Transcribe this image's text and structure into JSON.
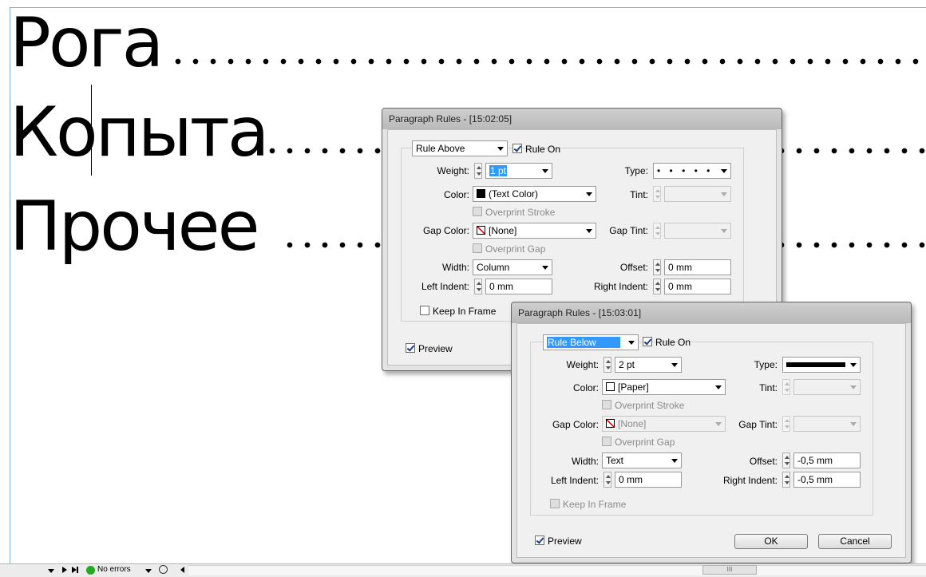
{
  "document": {
    "paragraphs": [
      "Рога",
      "Копыта",
      "Прочее"
    ]
  },
  "dialog_above": {
    "title": "Paragraph Rules - [15:02:05]",
    "rule_select": "Rule Above",
    "rule_on_label": "Rule On",
    "weight_label": "Weight:",
    "weight_value": "1 pt",
    "type_label": "Type:",
    "type_value": "• • • • •",
    "color_label": "Color:",
    "color_value": "(Text Color)",
    "tint_label": "Tint:",
    "overprint_stroke_label": "Overprint Stroke",
    "gap_color_label": "Gap Color:",
    "gap_color_value": "[None]",
    "gap_tint_label": "Gap Tint:",
    "overprint_gap_label": "Overprint Gap",
    "width_label": "Width:",
    "width_value": "Column",
    "offset_label": "Offset:",
    "offset_value": "0 mm",
    "left_indent_label": "Left Indent:",
    "left_indent_value": "0 mm",
    "right_indent_label": "Right Indent:",
    "right_indent_value": "0 mm",
    "keep_in_frame_label": "Keep In Frame",
    "preview_label": "Preview"
  },
  "dialog_below": {
    "title": "Paragraph Rules - [15:03:01]",
    "rule_select": "Rule Below",
    "rule_on_label": "Rule On",
    "weight_label": "Weight:",
    "weight_value": "2 pt",
    "type_label": "Type:",
    "color_label": "Color:",
    "color_value": "[Paper]",
    "tint_label": "Tint:",
    "overprint_stroke_label": "Overprint Stroke",
    "gap_color_label": "Gap Color:",
    "gap_color_value": "[None]",
    "gap_tint_label": "Gap Tint:",
    "overprint_gap_label": "Overprint Gap",
    "width_label": "Width:",
    "width_value": "Text",
    "offset_label": "Offset:",
    "offset_value": "-0,5 mm",
    "left_indent_label": "Left Indent:",
    "left_indent_value": "0 mm",
    "right_indent_label": "Right Indent:",
    "right_indent_value": "-0,5 mm",
    "keep_in_frame_label": "Keep In Frame",
    "preview_label": "Preview",
    "ok_label": "OK",
    "cancel_label": "Cancel"
  },
  "statusbar": {
    "preflight_text": "No errors",
    "preflight_status_color": "#22aa22",
    "scroll_thumb_glyph": "III"
  }
}
